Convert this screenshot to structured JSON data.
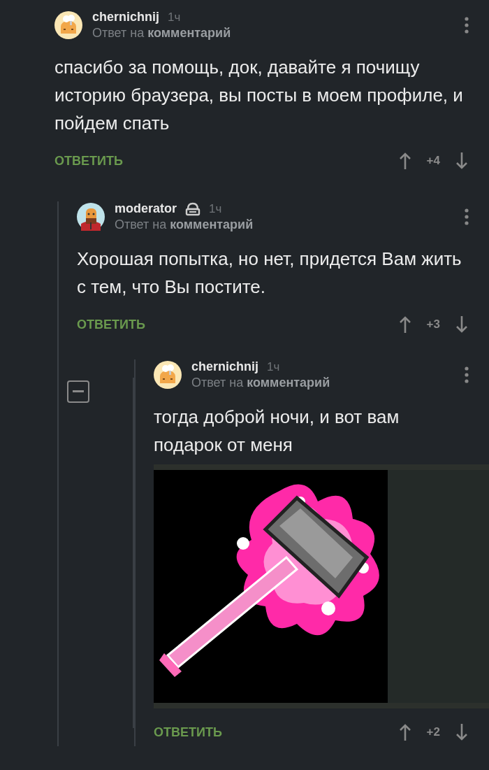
{
  "comments": [
    {
      "author": "chernichnij",
      "moderator": false,
      "time": "1ч",
      "reply_to": "Ответ на **комментарий**",
      "text": "спасибо за помощь, док, давайте я почищу историю браузера, вы посты в моем профиле, и пойдем спать",
      "reply": "ОТВЕТИТЬ",
      "score": "+4",
      "children": [
        {
          "author": "moderator",
          "moderator": true,
          "time": "1ч",
          "reply_to": "Ответ на **комментарий**",
          "text": "Хорошая попытка, но нет, придется Вам жить с тем, что Вы постите.",
          "reply": "ОТВЕТИТЬ",
          "score": "+3",
          "expanded": true,
          "children": [
            {
              "author": "chernichnij",
              "moderator": false,
              "time": "1ч",
              "reply_to": "Ответ на **комментарий**",
              "text": "тогда доброй ночи, и вот вам подарок от меня",
              "reply": "ОТВЕТИТЬ",
              "score": "+2"
            }
          ]
        }
      ]
    }
  ]
}
